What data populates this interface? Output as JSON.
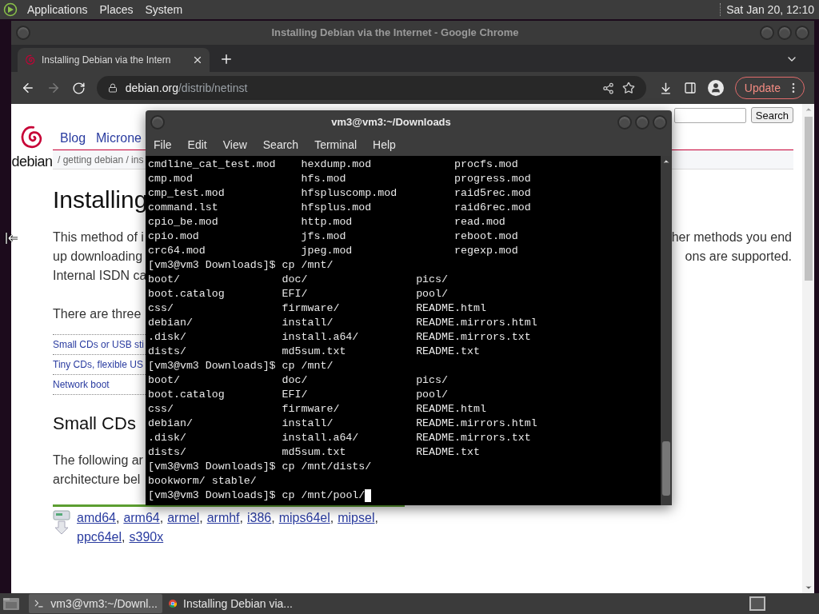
{
  "top_panel": {
    "menus": [
      "Applications",
      "Places",
      "System"
    ],
    "clock": "Sat Jan 20, 12:10"
  },
  "browser": {
    "title": "Installing Debian via the Internet - Google Chrome",
    "tabs": [
      {
        "label": "Installing Debian via the Intern",
        "selected": true
      }
    ],
    "forward_disabled": true,
    "address": {
      "domain": "debian.org",
      "path": "/distrib/netinst"
    },
    "update_button": "Update",
    "page": {
      "logo_text": "debian",
      "search_button": "Search",
      "nav": [
        "Blog",
        "Microne"
      ],
      "breadcrumb": "/ getting debian / ins",
      "heading": "Installing",
      "paragraph": [
        {
          "left": "This method of i",
          "right": "her methods you end"
        },
        {
          "left": "up downloading",
          "right": "ons are supported."
        },
        {
          "left": "Internal ISDN ca"
        }
      ],
      "intro": "There are three",
      "toc": [
        "Small CDs or USB sti",
        "Tiny CDs, flexible US",
        "Network boot"
      ],
      "subheading": "Small CDs",
      "following": [
        "The following ar",
        "architecture bel"
      ],
      "arch_links": [
        {
          "label": "amd64",
          "separator": ","
        },
        {
          "label": "arm64",
          "separator": ","
        },
        {
          "label": "armel",
          "separator": ","
        },
        {
          "label": "armhf",
          "separator": ","
        },
        {
          "label": "i386",
          "separator": ","
        },
        {
          "label": "mips64el",
          "separator": ","
        },
        {
          "label": "mipsel",
          "separator": ","
        },
        {
          "label": "ppc64el",
          "separator": ","
        },
        {
          "label": "s390x"
        }
      ]
    }
  },
  "terminal": {
    "title": "vm3@vm3:~/Downloads",
    "menus": [
      "File",
      "Edit",
      "View",
      "Search",
      "Terminal",
      "Help"
    ],
    "lines": [
      {
        "kind": "output",
        "text": "cmdline_cat_test.mod    hexdump.mod             procfs.mod"
      },
      {
        "kind": "output",
        "text": "cmp.mod                 hfs.mod                 progress.mod"
      },
      {
        "kind": "output",
        "text": "cmp_test.mod            hfspluscomp.mod         raid5rec.mod"
      },
      {
        "kind": "output",
        "text": "command.lst             hfsplus.mod             raid6rec.mod"
      },
      {
        "kind": "output",
        "text": "cpio_be.mod             http.mod                read.mod"
      },
      {
        "kind": "output",
        "text": "cpio.mod                jfs.mod                 reboot.mod"
      },
      {
        "kind": "output",
        "text": "crc64.mod               jpeg.mod                regexp.mod"
      },
      {
        "kind": "prompt",
        "prompt": "[vm3@vm3 Downloads]$",
        "command": "cp /mnt/",
        "cursor": false
      },
      {
        "kind": "output",
        "text": "boot/                doc/                 pics/"
      },
      {
        "kind": "output",
        "text": "boot.catalog         EFI/                 pool/"
      },
      {
        "kind": "output",
        "text": "css/                 firmware/            README.html"
      },
      {
        "kind": "output",
        "text": "debian/              install/             README.mirrors.html"
      },
      {
        "kind": "output",
        "text": ".disk/               install.a64/         README.mirrors.txt"
      },
      {
        "kind": "output",
        "text": "dists/               md5sum.txt           README.txt"
      },
      {
        "kind": "prompt",
        "prompt": "[vm3@vm3 Downloads]$",
        "command": "cp /mnt/",
        "cursor": false
      },
      {
        "kind": "output",
        "text": "boot/                doc/                 pics/"
      },
      {
        "kind": "output",
        "text": "boot.catalog         EFI/                 pool/"
      },
      {
        "kind": "output",
        "text": "css/                 firmware/            README.html"
      },
      {
        "kind": "output",
        "text": "debian/              install/             README.mirrors.html"
      },
      {
        "kind": "output",
        "text": ".disk/               install.a64/         README.mirrors.txt"
      },
      {
        "kind": "output",
        "text": "dists/               md5sum.txt           README.txt"
      },
      {
        "kind": "prompt",
        "prompt": "[vm3@vm3 Downloads]$",
        "command": "cp /mnt/dists/",
        "cursor": false
      },
      {
        "kind": "output",
        "text": "bookworm/ stable/"
      },
      {
        "kind": "prompt",
        "prompt": "[vm3@vm3 Downloads]$",
        "command": "cp /mnt/pool/",
        "cursor": true
      }
    ]
  },
  "taskbar": {
    "tasks": [
      {
        "kind": "terminal",
        "label": "vm3@vm3:~/Downl...",
        "selected": true
      },
      {
        "kind": "browser",
        "label": "Installing Debian via...",
        "selected": false
      }
    ]
  }
}
